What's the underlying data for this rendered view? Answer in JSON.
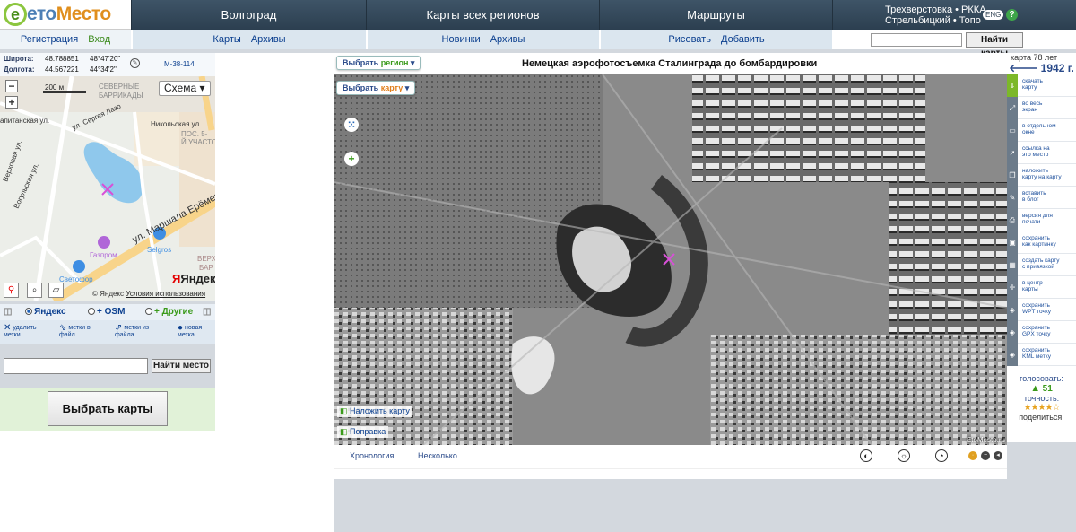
{
  "logo": {
    "prefix": "ето",
    "brand": "Место"
  },
  "header": {
    "sections": [
      "Волгоград",
      "Карты всех регионов",
      "Маршруты"
    ],
    "links_line1": "Трехверстовка • РККА",
    "links_line2": "Стрельбицкий • Топо",
    "lang": "ENG",
    "help": "?"
  },
  "subheader": {
    "register": "Регистрация",
    "login": "Вход",
    "maps": "Карты",
    "archives": "Архивы",
    "news": "Новинки",
    "archives2": "Архивы",
    "draw": "Рисовать",
    "add": "Добавить",
    "search_button": "Найти карты"
  },
  "coords": {
    "lat_label": "Широта:",
    "lat_dec": "48.788851",
    "lat_dms": "48°47'20\"",
    "lon_label": "Долгота:",
    "lon_dec": "44.567221",
    "lon_dms": "44°34'2\"",
    "sheet": "M-38-114"
  },
  "minimap": {
    "scale": "200 м",
    "schema": "Схема ▾",
    "labels": {
      "barrikady": "СЕВЕРНЫЕ БАРРИКАДЫ",
      "lazo": "ул. Сергея Лазо",
      "kapitan": "апитанская ул.",
      "nikol": "Никольская ул.",
      "pos": "ПОС. 5-",
      "uchastok": "Й УЧАСТОК",
      "verhovaya": "Верховая ул.",
      "vogulskaya": "Вогульская ул.",
      "selgros": "Selgros",
      "marshal": "ул. Маршала Ерёменко",
      "gazprom": "Газпром",
      "svetofor": "Светофор",
      "verh": "ВЕРХ",
      "bar": "БАР"
    },
    "yandex_brand": "Яндекс",
    "copyright": "© Яндекс",
    "terms": "Условия использования"
  },
  "providers": {
    "yandex": "Яндекс",
    "osm": "+ OSM",
    "other": "Другие"
  },
  "tools": {
    "delete": [
      "удалить",
      "метки"
    ],
    "to_file": [
      "метки в",
      "файл"
    ],
    "from_file": [
      "метки из",
      "файла"
    ],
    "new": [
      "новая",
      "метка"
    ]
  },
  "place_search": {
    "button": "Найти место"
  },
  "select_maps": "Выбрать карты",
  "map": {
    "title": "Немецкая аэрофотосъемка Сталинграда до бомбардировки",
    "select_region": {
      "a": "Выбрать ",
      "b": "регион"
    },
    "select_map": {
      "a": "Выбрать ",
      "b": "карту"
    },
    "overlay": "Наложить карту",
    "correction": "Поправка",
    "watermark": "EtoMesto.ru"
  },
  "bottom": {
    "chronology": "Хронология",
    "several": "Несколько"
  },
  "right": {
    "map_age": "карта 78 лет",
    "year": "1942 г.",
    "items": [
      [
        "скачать",
        "карту"
      ],
      [
        "во весь",
        "экран"
      ],
      [
        "в отдельном",
        "окне"
      ],
      [
        "ссылка на",
        "это место"
      ],
      [
        "наложить",
        "карту на карту"
      ],
      [
        "вставить",
        "в блог"
      ],
      [
        "версия для",
        "печати"
      ],
      [
        "сохранить",
        "как картинку"
      ],
      [
        "создать карту",
        "с привязкой"
      ],
      [
        "в центр",
        "карты"
      ],
      [
        "сохранить",
        "WPT точку"
      ],
      [
        "сохранить",
        "GPX точку"
      ],
      [
        "сохранить",
        "KML метку"
      ]
    ],
    "vote_label": "голосовать:",
    "vote_count": "51",
    "accuracy": "точность:",
    "stars": "★★★★☆",
    "share": "поделиться:"
  }
}
